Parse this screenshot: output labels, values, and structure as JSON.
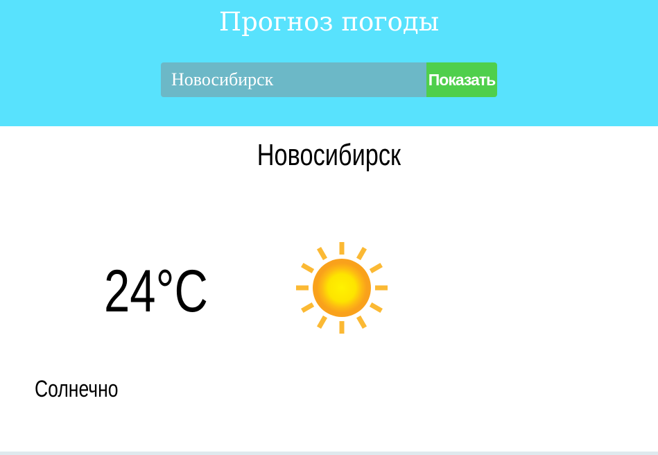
{
  "header": {
    "title": "Прогноз погоды",
    "background_color": "#58e2fd"
  },
  "search": {
    "value": "Новосибирск",
    "button_label": "Показать",
    "button_color": "#4fcf4c"
  },
  "weather": {
    "city": "Новосибирск",
    "temperature": "24°C",
    "condition": "Солнечно",
    "icon": "sun-icon"
  }
}
